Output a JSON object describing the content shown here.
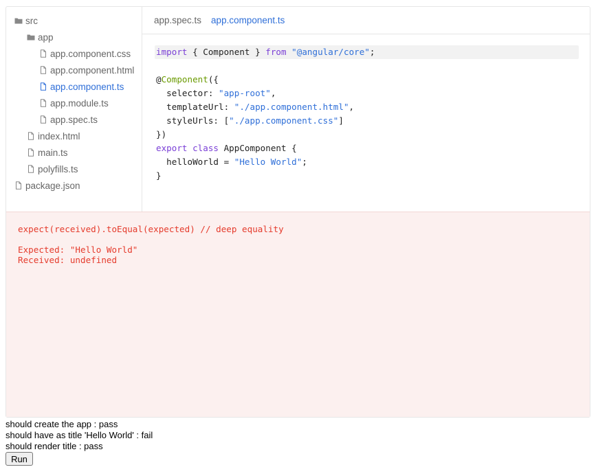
{
  "file_tree": [
    {
      "label": "src",
      "type": "folder",
      "level": 0
    },
    {
      "label": "app",
      "type": "folder",
      "level": 1
    },
    {
      "label": "app.component.css",
      "type": "file",
      "level": 2
    },
    {
      "label": "app.component.html",
      "type": "file",
      "level": 2
    },
    {
      "label": "app.component.ts",
      "type": "file",
      "level": 2,
      "active": true
    },
    {
      "label": "app.module.ts",
      "type": "file",
      "level": 2
    },
    {
      "label": "app.spec.ts",
      "type": "file",
      "level": 2
    },
    {
      "label": "index.html",
      "type": "file",
      "level": 1
    },
    {
      "label": "main.ts",
      "type": "file",
      "level": 1
    },
    {
      "label": "polyfills.ts",
      "type": "file",
      "level": 1
    },
    {
      "label": "package.json",
      "type": "file",
      "level": 0
    }
  ],
  "tabs": [
    {
      "label": "app.spec.ts",
      "active": false
    },
    {
      "label": "app.component.ts",
      "active": true
    }
  ],
  "code": {
    "line1": {
      "kw1": "import",
      "t1": " { Component } ",
      "kw2": "from",
      "t2": " ",
      "s1": "\"@angular/core\"",
      "t3": ";"
    },
    "line3": {
      "t1": "@",
      "dec": "Component",
      "t2": "({"
    },
    "line4": {
      "t1": "  selector: ",
      "s1": "\"app-root\"",
      "t2": ","
    },
    "line5": {
      "t1": "  templateUrl: ",
      "s1": "\"./app.component.html\"",
      "t2": ","
    },
    "line6": {
      "t1": "  styleUrls: [",
      "s1": "\"./app.component.css\"",
      "t2": "]"
    },
    "line7": {
      "t1": "})"
    },
    "line8": {
      "kw1": "export",
      "t1": " ",
      "kw2": "class",
      "t2": " AppComponent {"
    },
    "line9": {
      "t1": "  helloWorld = ",
      "s1": "\"Hello World\"",
      "t2": ";"
    },
    "line10": {
      "t1": "}"
    }
  },
  "error": {
    "matcher": "expect(received).toEqual(expected) // deep equality",
    "expected": "Expected: \"Hello World\"",
    "received": "Received: undefined"
  },
  "results": [
    "should create the app : pass",
    "should have as title 'Hello World' : fail",
    "should render title : pass"
  ],
  "run_label": "Run",
  "icons": {
    "folder": "folder-icon",
    "file": "file-icon"
  },
  "colors": {
    "accent": "#2f6fd8",
    "error_text": "#e53b2c",
    "error_bg": "#fcf0ef",
    "keyword": "#7a3fd6",
    "decorator": "#6a9a00"
  }
}
